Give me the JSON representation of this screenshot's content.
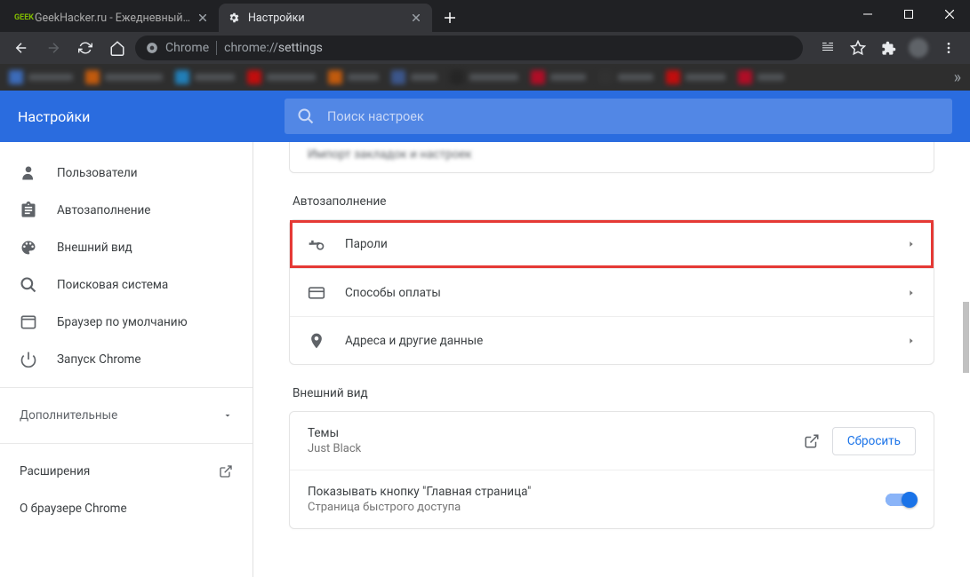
{
  "window": {
    "minimize": "min",
    "maximize": "max",
    "close": "close"
  },
  "tabs": [
    {
      "title": "GeekHacker.ru - Ежедневный жу",
      "favicon_text": "GEEK",
      "active": false
    },
    {
      "title": "Настройки",
      "active": true
    }
  ],
  "omnibox": {
    "scheme_label": "Chrome",
    "url_path": "chrome://settings"
  },
  "bookmark_overflow": "»",
  "header": {
    "title": "Настройки",
    "search_placeholder": "Поиск настроек"
  },
  "sidebar": {
    "nav": [
      {
        "id": "users",
        "label": "Пользователи",
        "icon": "person"
      },
      {
        "id": "autofill",
        "label": "Автозаполнение",
        "icon": "assignment"
      },
      {
        "id": "appearance",
        "label": "Внешний вид",
        "icon": "palette"
      },
      {
        "id": "search",
        "label": "Поисковая система",
        "icon": "search"
      },
      {
        "id": "default",
        "label": "Браузер по умолчанию",
        "icon": "browser"
      },
      {
        "id": "startup",
        "label": "Запуск Chrome",
        "icon": "power"
      }
    ],
    "advanced_label": "Дополнительные",
    "extensions_label": "Расширения",
    "about_label": "О браузере Chrome"
  },
  "content": {
    "truncated_row": "Импорт закладок и настроек",
    "section_autofill": "Автозаполнение",
    "autofill_rows": [
      {
        "id": "passwords",
        "label": "Пароли",
        "icon": "key",
        "highlight": true
      },
      {
        "id": "payment",
        "label": "Способы оплаты",
        "icon": "card",
        "highlight": false
      },
      {
        "id": "addresses",
        "label": "Адреса и другие данные",
        "icon": "place",
        "highlight": false
      }
    ],
    "section_appearance": "Внешний вид",
    "themes": {
      "label": "Темы",
      "sub": "Just Black",
      "reset": "Сбросить"
    },
    "home_button": {
      "label": "Показывать кнопку \"Главная страница\"",
      "sub": "Страница быстрого доступа"
    }
  }
}
